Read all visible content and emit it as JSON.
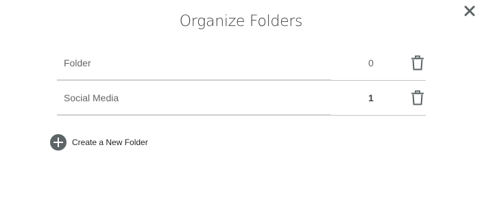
{
  "modal": {
    "title": "Organize Folders",
    "close_icon": "close-icon",
    "close_glyph": "✕"
  },
  "folders": [
    {
      "name": "Folder",
      "count": "0"
    },
    {
      "name": "Social Media",
      "count": "1"
    }
  ],
  "actions": {
    "create_label": "Create a New Folder",
    "create_icon": "plus-circle-icon",
    "delete_icon": "trash-icon"
  },
  "colors": {
    "icon_dark": "#5d6466",
    "divider": "#cfcfcf",
    "text_muted": "#666666"
  }
}
